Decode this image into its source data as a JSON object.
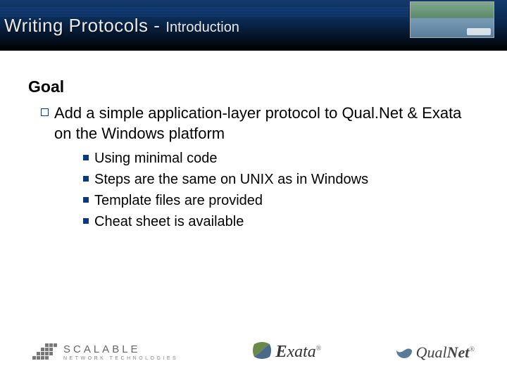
{
  "header": {
    "title_main": "Writing Protocols -",
    "title_sub": "Introduction"
  },
  "content": {
    "heading": "Goal",
    "main_item": "Add a simple application-layer protocol to Qual.Net & Exata on the Windows platform",
    "sub_items": [
      "Using minimal code",
      "Steps are the same on UNIX as in Windows",
      "Template files are provided",
      "Cheat sheet is available"
    ]
  },
  "footer": {
    "scalable": {
      "line1": "SCALABLE",
      "line2": "NETWORK TECHNOLOGIES"
    },
    "exata": "Exata",
    "qualnet_q": "Qual",
    "qualnet_n": "Net"
  }
}
